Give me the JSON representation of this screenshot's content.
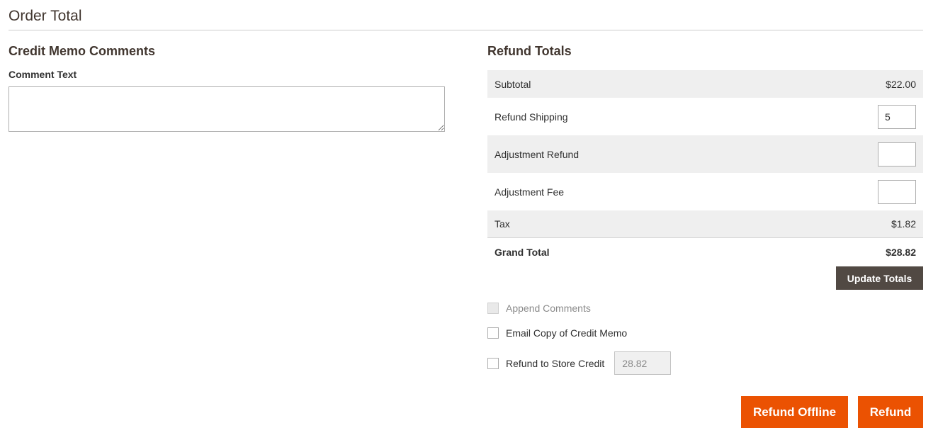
{
  "section": {
    "title": "Order Total"
  },
  "comments": {
    "heading": "Credit Memo Comments",
    "label": "Comment Text",
    "value": ""
  },
  "totals": {
    "heading": "Refund Totals",
    "subtotal": {
      "label": "Subtotal",
      "value": "$22.00"
    },
    "refund_shipping": {
      "label": "Refund Shipping",
      "value": "5"
    },
    "adjustment_refund": {
      "label": "Adjustment Refund",
      "value": ""
    },
    "adjustment_fee": {
      "label": "Adjustment Fee",
      "value": ""
    },
    "tax": {
      "label": "Tax",
      "value": "$1.82"
    },
    "grand_total": {
      "label": "Grand Total",
      "value": "$28.82"
    },
    "update_label": "Update Totals"
  },
  "options": {
    "append_comments": {
      "label": "Append Comments",
      "checked": false,
      "disabled": true
    },
    "email_copy": {
      "label": "Email Copy of Credit Memo",
      "checked": false
    },
    "store_credit": {
      "label": "Refund to Store Credit",
      "checked": false,
      "value": "28.82"
    }
  },
  "actions": {
    "refund_offline": "Refund Offline",
    "refund": "Refund"
  },
  "colors": {
    "accent": "#eb5202",
    "secondary_button": "#514943",
    "row_shade": "#efefef"
  }
}
